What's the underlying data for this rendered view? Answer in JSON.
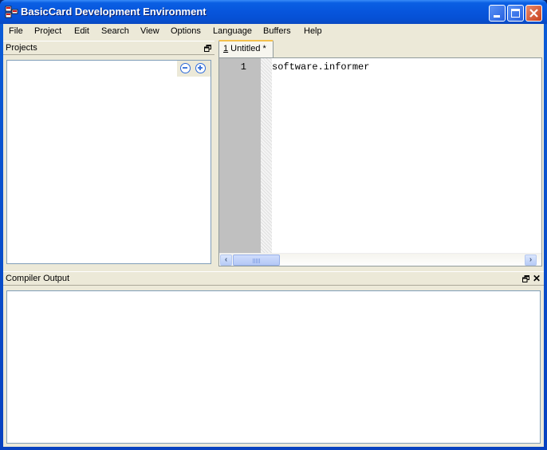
{
  "window": {
    "title": "BasicCard Development Environment",
    "icons": {
      "app": "app-cards-icon",
      "minimize": "minimize-icon",
      "maximize": "maximize-icon",
      "close": "close-icon"
    }
  },
  "menubar": {
    "items": [
      {
        "label": "File"
      },
      {
        "label": "Project"
      },
      {
        "label": "Edit"
      },
      {
        "label": "Search"
      },
      {
        "label": "View"
      },
      {
        "label": "Options"
      },
      {
        "label": "Language"
      },
      {
        "label": "Buffers"
      },
      {
        "label": "Help"
      }
    ]
  },
  "projects_panel": {
    "title": "Projects",
    "collapse_icon": "minus-circle-icon",
    "expand_icon": "plus-circle-icon",
    "restore_icon": "restore-window-icon"
  },
  "editor": {
    "tabs": [
      {
        "mnemonic": "1",
        "label": " Untitled *"
      }
    ],
    "lines": [
      {
        "number": "1",
        "text": "software.informer"
      }
    ],
    "scroll_left": "‹",
    "scroll_right": "›"
  },
  "output_panel": {
    "title": "Compiler Output",
    "restore_icon": "restore-window-icon",
    "close_glyph": "✕"
  }
}
